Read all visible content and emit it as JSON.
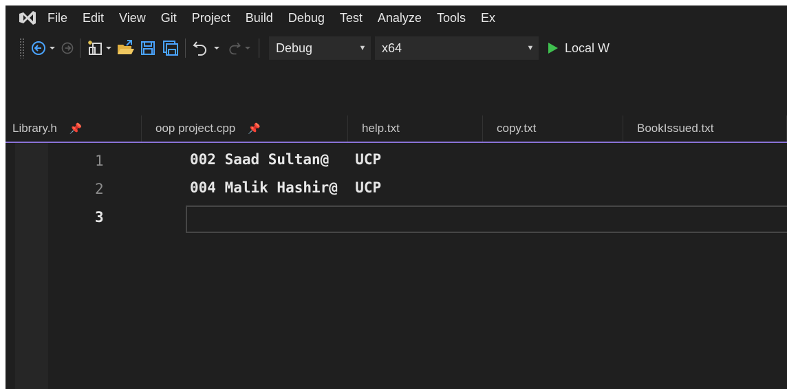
{
  "menu": {
    "items": [
      "File",
      "Edit",
      "View",
      "Git",
      "Project",
      "Build",
      "Debug",
      "Test",
      "Analyze",
      "Tools",
      "Ex"
    ]
  },
  "toolbar": {
    "configuration": "Debug",
    "platform": "x64",
    "run_label": "Local W",
    "run_color": "#3fbf4f"
  },
  "tabs": [
    {
      "label": "Library.h",
      "pinned": true
    },
    {
      "label": "oop project.cpp",
      "pinned": true
    },
    {
      "label": "help.txt",
      "pinned": false
    },
    {
      "label": "copy.txt",
      "pinned": false
    },
    {
      "label": "BookIssued.txt",
      "pinned": false
    }
  ],
  "editor": {
    "line_numbers": [
      "1",
      "2",
      "3"
    ],
    "lines": [
      "002 Saad Sultan@   UCP",
      "004 Malik Hashir@  UCP",
      ""
    ],
    "current_line": 3
  },
  "colors": {
    "tab_underline": "#8a72d8",
    "background": "#1f1f1f"
  }
}
